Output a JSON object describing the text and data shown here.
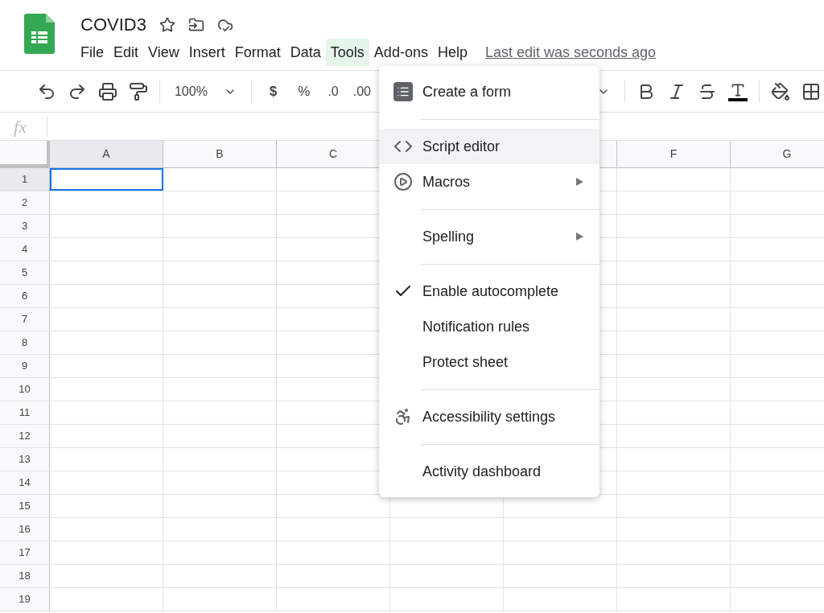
{
  "document": {
    "title": "COVID3",
    "starred": false,
    "last_edit": "Last edit was seconds ago"
  },
  "menu_bar": [
    {
      "label": "File",
      "selected": false
    },
    {
      "label": "Edit",
      "selected": false
    },
    {
      "label": "View",
      "selected": false
    },
    {
      "label": "Insert",
      "selected": false
    },
    {
      "label": "Format",
      "selected": false
    },
    {
      "label": "Data",
      "selected": false
    },
    {
      "label": "Tools",
      "selected": true
    },
    {
      "label": "Add-ons",
      "selected": false
    },
    {
      "label": "Help",
      "selected": false
    }
  ],
  "toolbar": {
    "zoom": "100%",
    "currency": "$",
    "percent": "%",
    "decrease_decimals": ".0",
    "increase_decimals": ".00"
  },
  "formula_bar": {
    "label": "fx"
  },
  "columns": [
    "A",
    "B",
    "C",
    null,
    null,
    "F",
    "G"
  ],
  "rows": [
    "1",
    "2",
    "3",
    "4",
    "5",
    "6",
    "7",
    "8",
    "9",
    "10",
    "11",
    "12",
    "13",
    "14",
    "15",
    "16",
    "17",
    "18",
    "19"
  ],
  "tools_menu": [
    {
      "kind": "form",
      "label": "Create a form",
      "selected": false
    },
    {
      "kind": "separator"
    },
    {
      "kind": "script",
      "label": "Script editor",
      "selected": true
    },
    {
      "kind": "macro",
      "label": "Macros",
      "selected": false,
      "submenu": true
    },
    {
      "kind": "separator"
    },
    {
      "kind": "plain",
      "label": "Spelling",
      "selected": false,
      "submenu": true
    },
    {
      "kind": "separator"
    },
    {
      "kind": "toggle",
      "label": "Enable autocomplete",
      "selected": false,
      "checked": true
    },
    {
      "kind": "plain",
      "label": "Notification rules",
      "selected": false
    },
    {
      "kind": "plain",
      "label": "Protect sheet",
      "selected": false
    },
    {
      "kind": "separator"
    },
    {
      "kind": "accessibility",
      "label": "Accessibility settings",
      "selected": false
    },
    {
      "kind": "separator"
    },
    {
      "kind": "plain",
      "label": "Activity dashboard",
      "selected": false
    }
  ]
}
